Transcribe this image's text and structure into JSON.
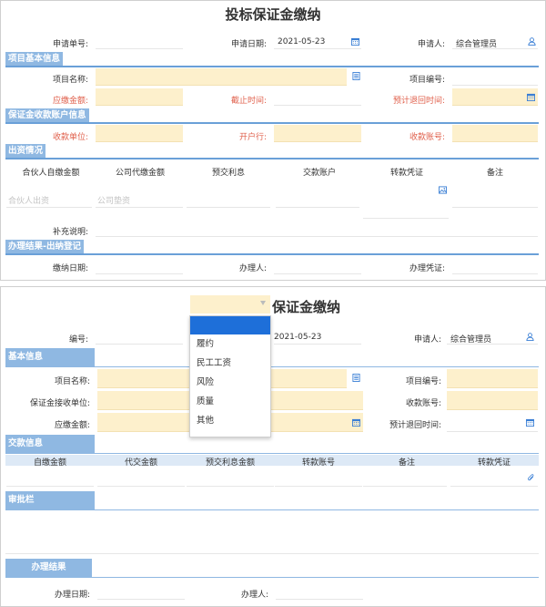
{
  "panel1": {
    "title": "投标保证金缴纳",
    "apply_no_label": "申请单号:",
    "apply_date_label": "申请日期:",
    "apply_date_value": "2021-05-23",
    "applicant_label": "申请人:",
    "applicant_value": "综合管理员",
    "section_basic": "项目基本信息",
    "project_name_label": "项目名称:",
    "project_no_label": "项目编号:",
    "pay_amount_label": "应缴金额:",
    "deadline_label": "截止时间:",
    "return_time_label": "预计退回时间:",
    "section_account": "保证金收款账户信息",
    "payee_label": "收款单位:",
    "bank_label": "开户行:",
    "account_label": "收款账号:",
    "section_funding": "出资情况",
    "funding_columns": [
      "合伙人自缴金额",
      "公司代缴金额",
      "预交利息",
      "交款账户",
      "转款凭证",
      "备注"
    ],
    "partner_placeholder": "合伙人出资",
    "company_placeholder": "公司垫资",
    "remark_label": "补充说明:",
    "section_result": "办理结果-出纳登记",
    "pay_date_label": "缴纳日期:",
    "handler_label": "办理人:",
    "voucher_label": "办理凭证:"
  },
  "panel2": {
    "title": "保证金缴纳",
    "no_label": "编号:",
    "date_value": "2021-05-23",
    "applicant_label": "申请人:",
    "applicant_value": "综合管理员",
    "section_basic": "基本信息",
    "project_name_label": "项目名称:",
    "project_no_label": "项目编号:",
    "receiver_label": "保证金接收单位:",
    "account_label": "收款账号:",
    "pay_amount_label": "应缴金额:",
    "return_time_label": "预计退回时间:",
    "section_pay": "交款信息",
    "pay_columns": [
      "自缴金额",
      "代交金额",
      "预交利息金额",
      "转款账号",
      "备注",
      "转款凭证"
    ],
    "section_approval": "审批栏",
    "section_result": "办理结果",
    "handle_date_label": "办理日期:",
    "handler_label": "办理人:"
  },
  "dropdown": {
    "options": [
      "履约",
      "民工工资",
      "风险",
      "质量",
      "其他"
    ]
  },
  "colors": {
    "section_bg": "#8fb8e2",
    "required_field_bg": "#fdf0cc",
    "required_label": "#e0604c",
    "icon_blue": "#3a7fd5"
  }
}
